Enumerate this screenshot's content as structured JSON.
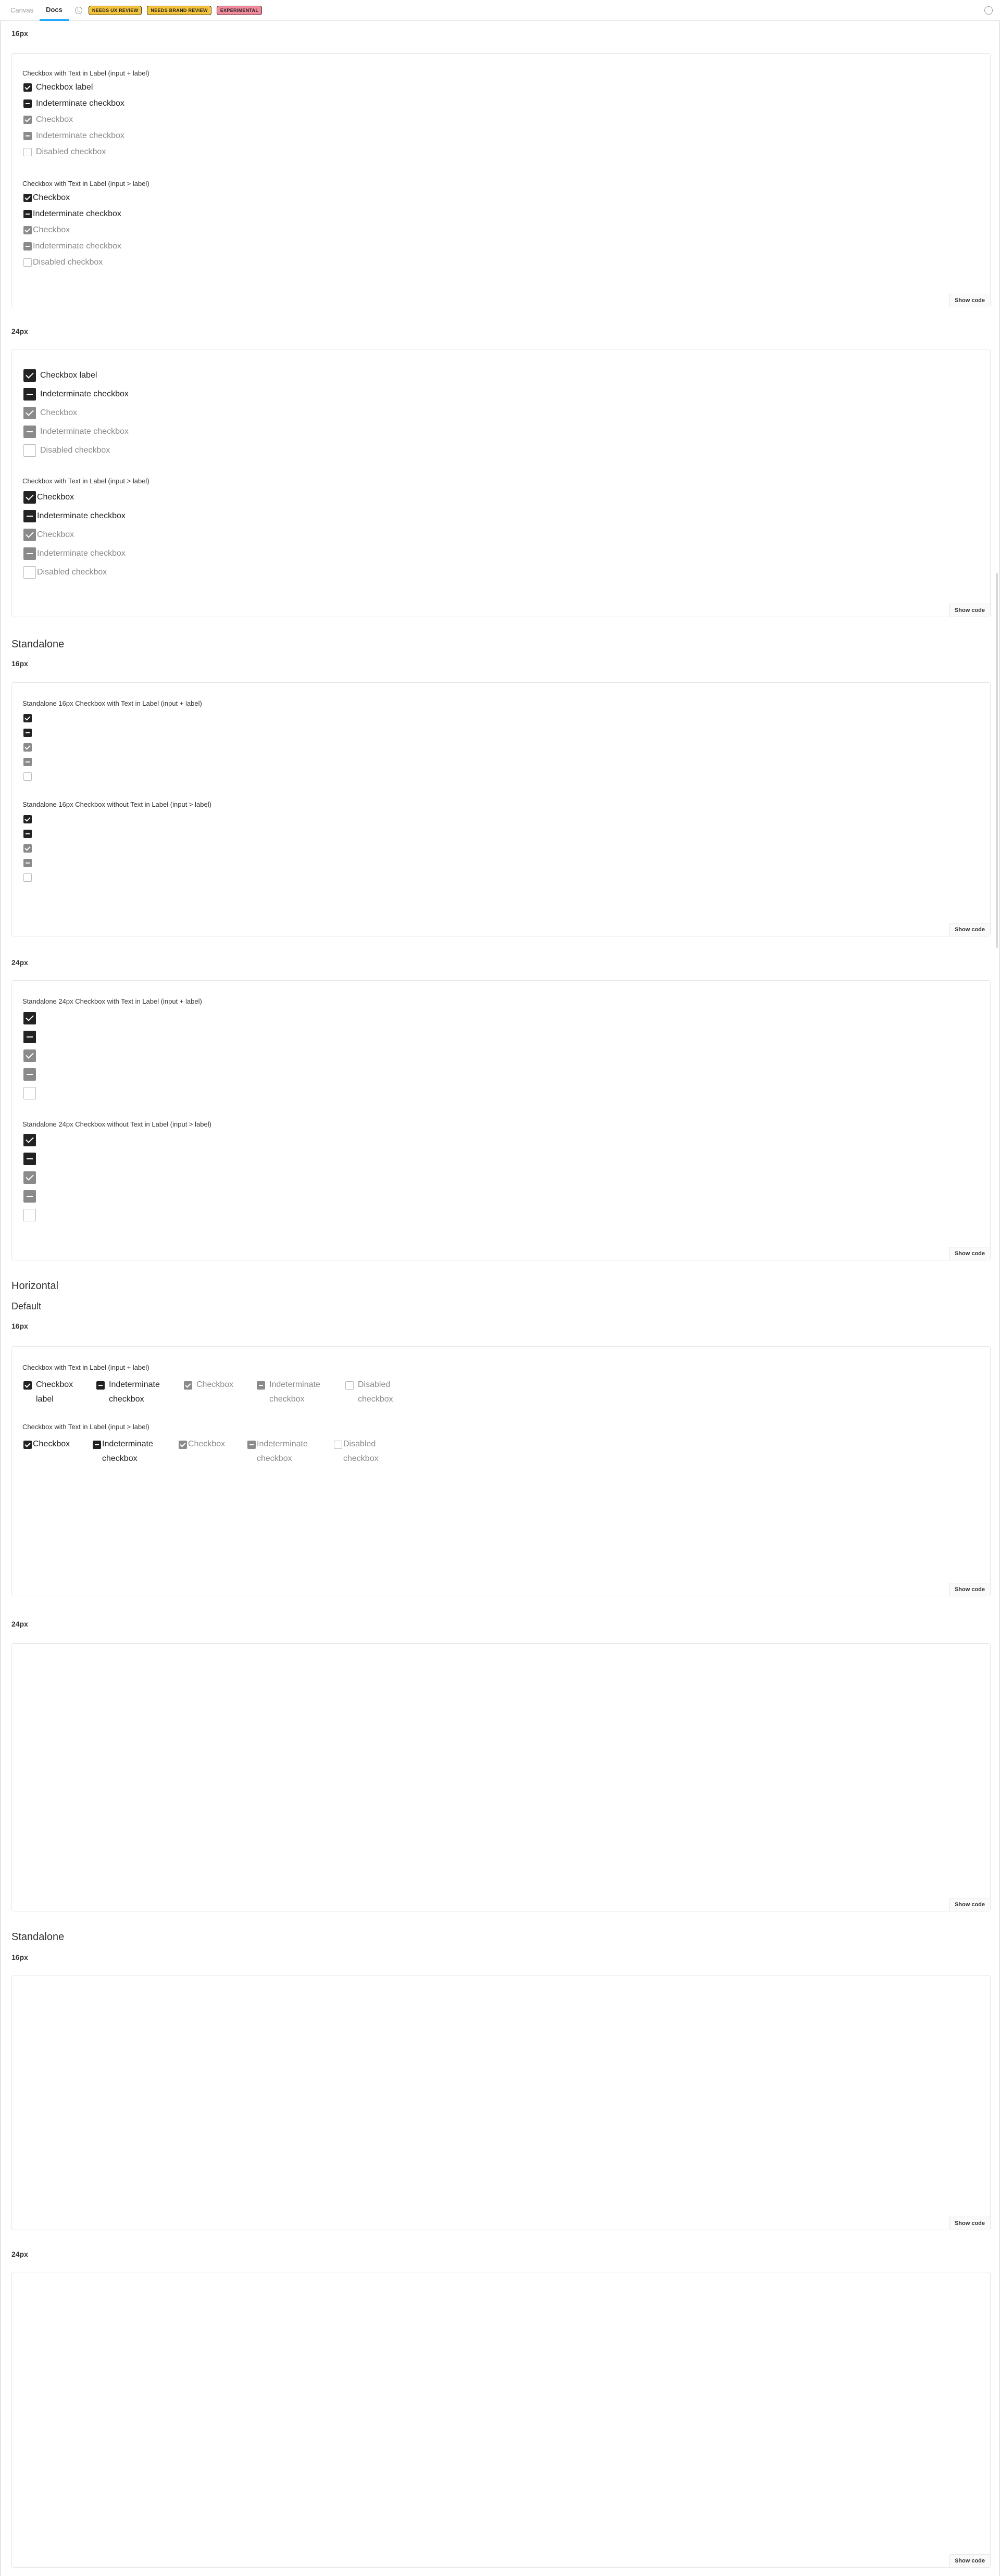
{
  "toolbar": {
    "tabs": [
      {
        "label": "Canvas"
      },
      {
        "label": "Docs"
      }
    ],
    "badges": [
      {
        "label": "NEEDS UX REVIEW"
      },
      {
        "label": "NEEDS BRAND REVIEW"
      },
      {
        "label": "EXPERIMENTAL"
      }
    ]
  },
  "colors": {
    "accent": "#1ea7fd",
    "badge_yellow": "#f3c33b",
    "badge_red": "#f08a9c",
    "checkbox_dark": "#222222",
    "checkbox_disabled": "#8a8a8a"
  },
  "sizes": {
    "s16": "16px",
    "s24": "24px"
  },
  "sections": {
    "standalone": "Standalone",
    "horizontal": "Horizontal",
    "default": "Default"
  },
  "show_code": "Show code",
  "groups": {
    "with_label_plus": "Checkbox with Text in Label (input + label)",
    "with_label_gt": "Checkbox with Text in Label (input > label)",
    "sa16_with": "Standalone 16px Checkbox with Text in Label (input + label)",
    "sa16_without": "Standalone 16px Checkbox without Text in Label (input > label)",
    "sa24_with": "Standalone 24px Checkbox with Text in Label (input + label)",
    "sa24_without": "Standalone 24px Checkbox without Text in Label (input > label)"
  },
  "labels": {
    "checkbox_label": "Checkbox label",
    "checkbox": "Checkbox",
    "indeterminate": "Indeterminate checkbox",
    "disabled": "Disabled checkbox"
  }
}
